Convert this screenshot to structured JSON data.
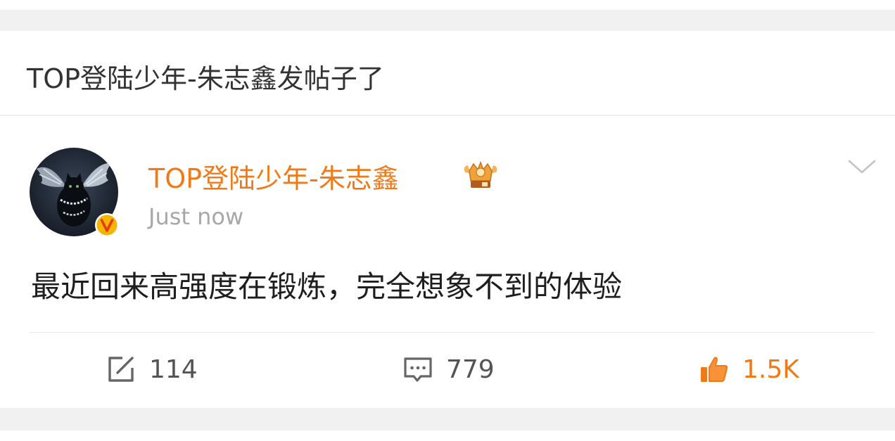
{
  "notification": {
    "text": "TOP登陆少年-朱志鑫发帖子了"
  },
  "post": {
    "author": "TOP登陆少年-朱志鑫",
    "time": "Just now",
    "content": "最近回来高强度在锻炼，完全想象不到的体验",
    "badges": [
      "verified-v-icon",
      "crown-member-icon"
    ],
    "actions": {
      "repost_count": "114",
      "comment_count": "779",
      "like_count": "1.5K"
    }
  },
  "colors": {
    "accent": "#f07a18",
    "verified": "#f5b400",
    "text": "#1e1e1e",
    "muted": "#a8a8a8",
    "background": "#f1f1f1"
  }
}
